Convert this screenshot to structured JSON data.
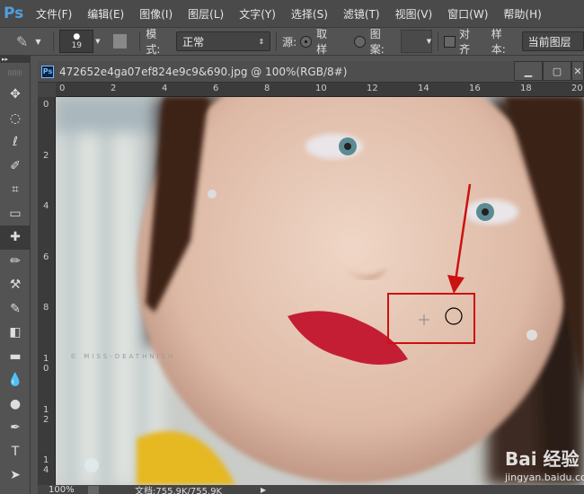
{
  "app": {
    "logo": "Ps"
  },
  "menu": [
    "文件(F)",
    "编辑(E)",
    "图像(I)",
    "图层(L)",
    "文字(Y)",
    "选择(S)",
    "滤镜(T)",
    "视图(V)",
    "窗口(W)",
    "帮助(H)"
  ],
  "options": {
    "brush_size": "19",
    "mode_label": "模式:",
    "mode_value": "正常",
    "source_label": "源:",
    "sampled_label": "取样",
    "pattern_label": "图案:",
    "aligned_label": "对齐",
    "sample_label": "样本:",
    "sample_value": "当前图层"
  },
  "tools": [
    "move-tool",
    "marquee-tool",
    "lasso-tool",
    "quick-select-tool",
    "crop-tool",
    "ruler-tool",
    "healing-brush-tool",
    "brush-tool",
    "clone-stamp-tool",
    "history-brush-tool",
    "eraser-tool",
    "gradient-tool",
    "blur-tool",
    "dodge-tool",
    "pen-tool",
    "type-tool",
    "path-select-tool"
  ],
  "document": {
    "title": "472652e4ga07ef824e9c9&690.jpg @ 100%(RGB/8#)",
    "zoom": "100%",
    "doc_info": "文档:755.9K/755.9K"
  },
  "rulers": {
    "h": [
      "0",
      "2",
      "4",
      "6",
      "8",
      "10",
      "12",
      "14",
      "16",
      "18",
      "20"
    ],
    "v": [
      "0",
      "2",
      "4",
      "6",
      "8",
      "10",
      "12",
      "14"
    ]
  },
  "image": {
    "watermark": "© MISS-DEATHNISH",
    "baidu_logo": "Bai 经验",
    "baidu_url": "jingyan.baidu.com"
  },
  "colors": {
    "annotation": "#cc1111",
    "ps_blue": "#4e9fe0"
  }
}
